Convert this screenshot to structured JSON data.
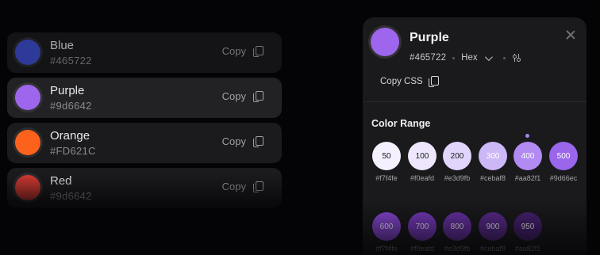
{
  "colors": {
    "blue": "#465722",
    "blue_display": "#3f4fd0",
    "purple_display": "#9d66ec",
    "orange_display": "#fd621c",
    "red_display": "#d33b32"
  },
  "color_list": [
    {
      "name": "Blue",
      "hex": "#465722",
      "copy_label": "Copy"
    },
    {
      "name": "Purple",
      "hex": "#9d6642",
      "copy_label": "Copy"
    },
    {
      "name": "Orange",
      "hex": "#FD621C",
      "copy_label": "Copy"
    },
    {
      "name": "Red",
      "hex": "#9d6642",
      "copy_label": "Copy"
    }
  ],
  "detail": {
    "title": "Purple",
    "hex": "#465722",
    "format": "Hex",
    "copy_css_label": "Copy CSS",
    "range_title": "Color Range",
    "shades": [
      {
        "step": "50",
        "hex": "#f7f4fe",
        "fill": "#f4f0fd",
        "text_color": "#1a1a1d"
      },
      {
        "step": "100",
        "hex": "#f0eafd",
        "fill": "#ede6fc",
        "text_color": "#1a1a1d"
      },
      {
        "step": "200",
        "hex": "#e3d9fb",
        "fill": "#e1d5fb",
        "text_color": "#1a1a1d"
      },
      {
        "step": "300",
        "hex": "#cebaf8",
        "fill": "#cdb8f7",
        "text_color": "#ffffff"
      },
      {
        "step": "400",
        "hex": "#aa82f1",
        "fill": "#b28af3",
        "text_color": "#ffffff",
        "selected": true
      },
      {
        "step": "500",
        "hex": "#9d66ec",
        "fill": "#9a66ec",
        "text_color": "#ffffff"
      },
      {
        "step": "600",
        "hex": "#f7f4fe",
        "fill": "#8b49db",
        "text_color": "#ffffff"
      },
      {
        "step": "700",
        "hex": "#f0eafd",
        "fill": "#7c3cc4",
        "text_color": "#ffffff"
      },
      {
        "step": "800",
        "hex": "#e3d9fb",
        "fill": "#6d33ac",
        "text_color": "#ffffff"
      },
      {
        "step": "900",
        "hex": "#cebaf8",
        "fill": "#5d2c92",
        "text_color": "#ffffff"
      },
      {
        "step": "950",
        "hex": "#aa82f1",
        "fill": "#4a2277",
        "text_color": "#ffffff"
      }
    ]
  }
}
